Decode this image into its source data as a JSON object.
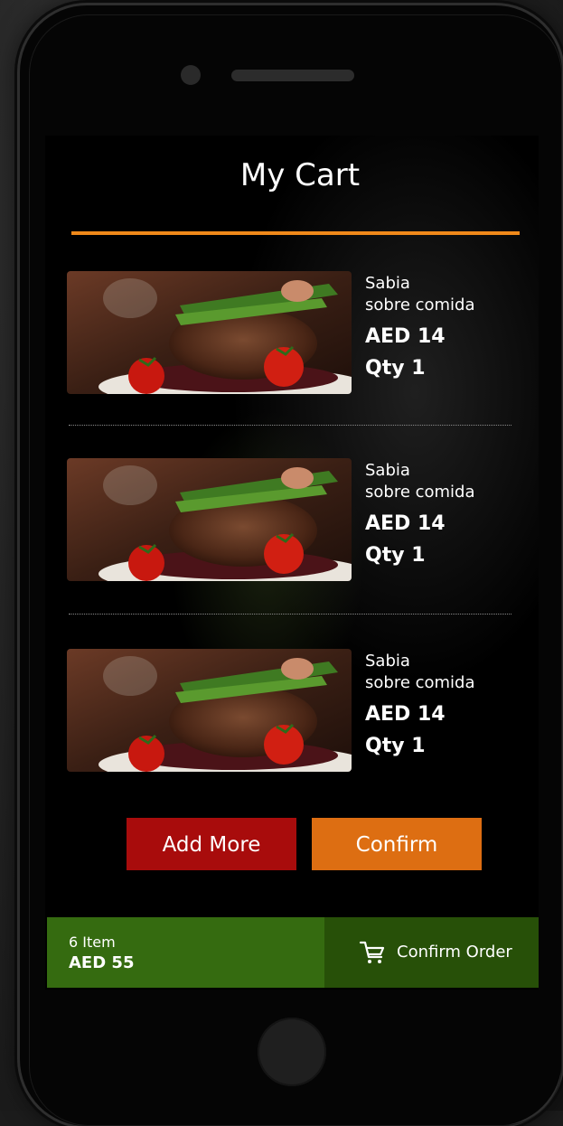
{
  "header": {
    "title": "My Cart"
  },
  "cart": {
    "items": [
      {
        "name_line1": "Sabia",
        "name_line2": "sobre comida",
        "price": "AED 14",
        "qty": "Qty 1",
        "image": "steak-asparagus-photo"
      },
      {
        "name_line1": "Sabia",
        "name_line2": "sobre comida",
        "price": "AED 14",
        "qty": "Qty 1",
        "image": "steak-asparagus-photo"
      },
      {
        "name_line1": "Sabia",
        "name_line2": "sobre comida",
        "price": "AED 14",
        "qty": "Qty 1",
        "image": "steak-asparagus-photo"
      }
    ]
  },
  "actions": {
    "add_more_label": "Add More",
    "confirm_label": "Confirm"
  },
  "order_bar": {
    "item_count": "6 Item",
    "total": "AED 55",
    "confirm_order_label": "Confirm Order",
    "icon": "cart-icon"
  },
  "colors": {
    "accent_orange": "#f0891a",
    "add_more_red": "#a80c0c",
    "confirm_orange": "#dd6e12",
    "summary_green": "#356b10",
    "confirm_order_green": "#275008"
  }
}
